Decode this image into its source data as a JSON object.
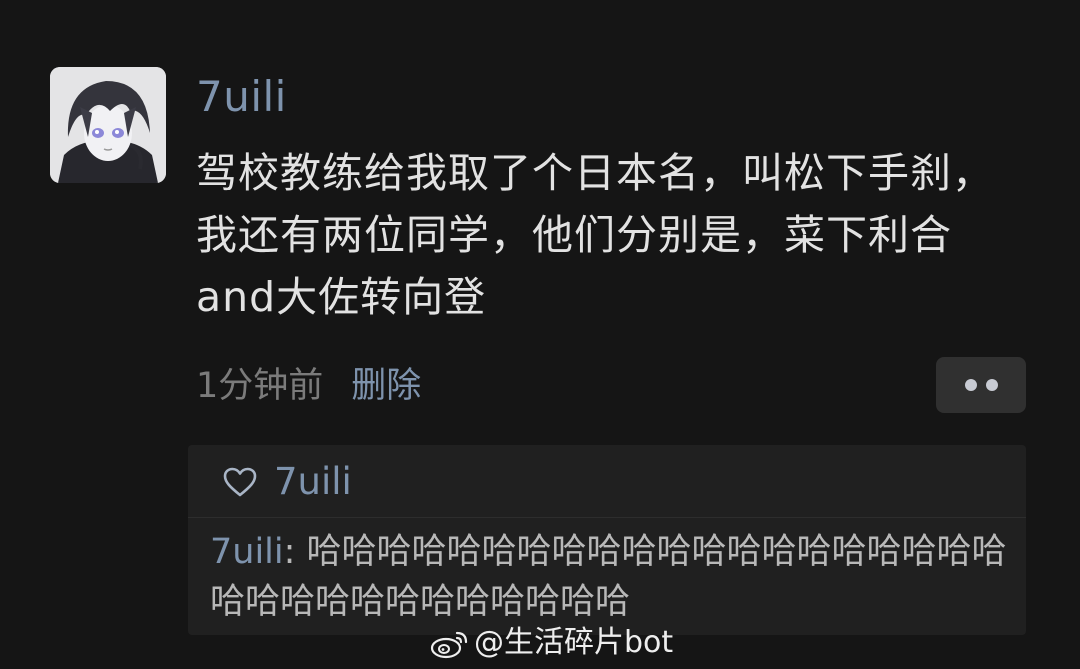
{
  "post": {
    "username": "7uili",
    "text": "驾校教练给我取了个日本名，叫松下手刹，我还有两位同学，他们分别是，菜下利合 and大佐转向登",
    "time": "1分钟前",
    "delete_label": "删除"
  },
  "icons": {
    "avatar": "anime-avatar",
    "more": "more-dots-icon",
    "like": "heart-icon",
    "watermark": "weibo-logo-icon"
  },
  "reply_card": {
    "liked_by": "7uili",
    "comment": {
      "user": "7uili",
      "separator": ": ",
      "text": "哈哈哈哈哈哈哈哈哈哈哈哈哈哈哈哈哈哈哈哈哈哈哈哈哈哈哈哈哈哈哈哈"
    }
  },
  "watermark": {
    "text": "@生活碎片bot"
  },
  "colors": {
    "background": "#151515",
    "username": "#7e93ad",
    "post_text": "#e2e2e2",
    "meta": "#7b7b7b",
    "card": "#202020"
  }
}
